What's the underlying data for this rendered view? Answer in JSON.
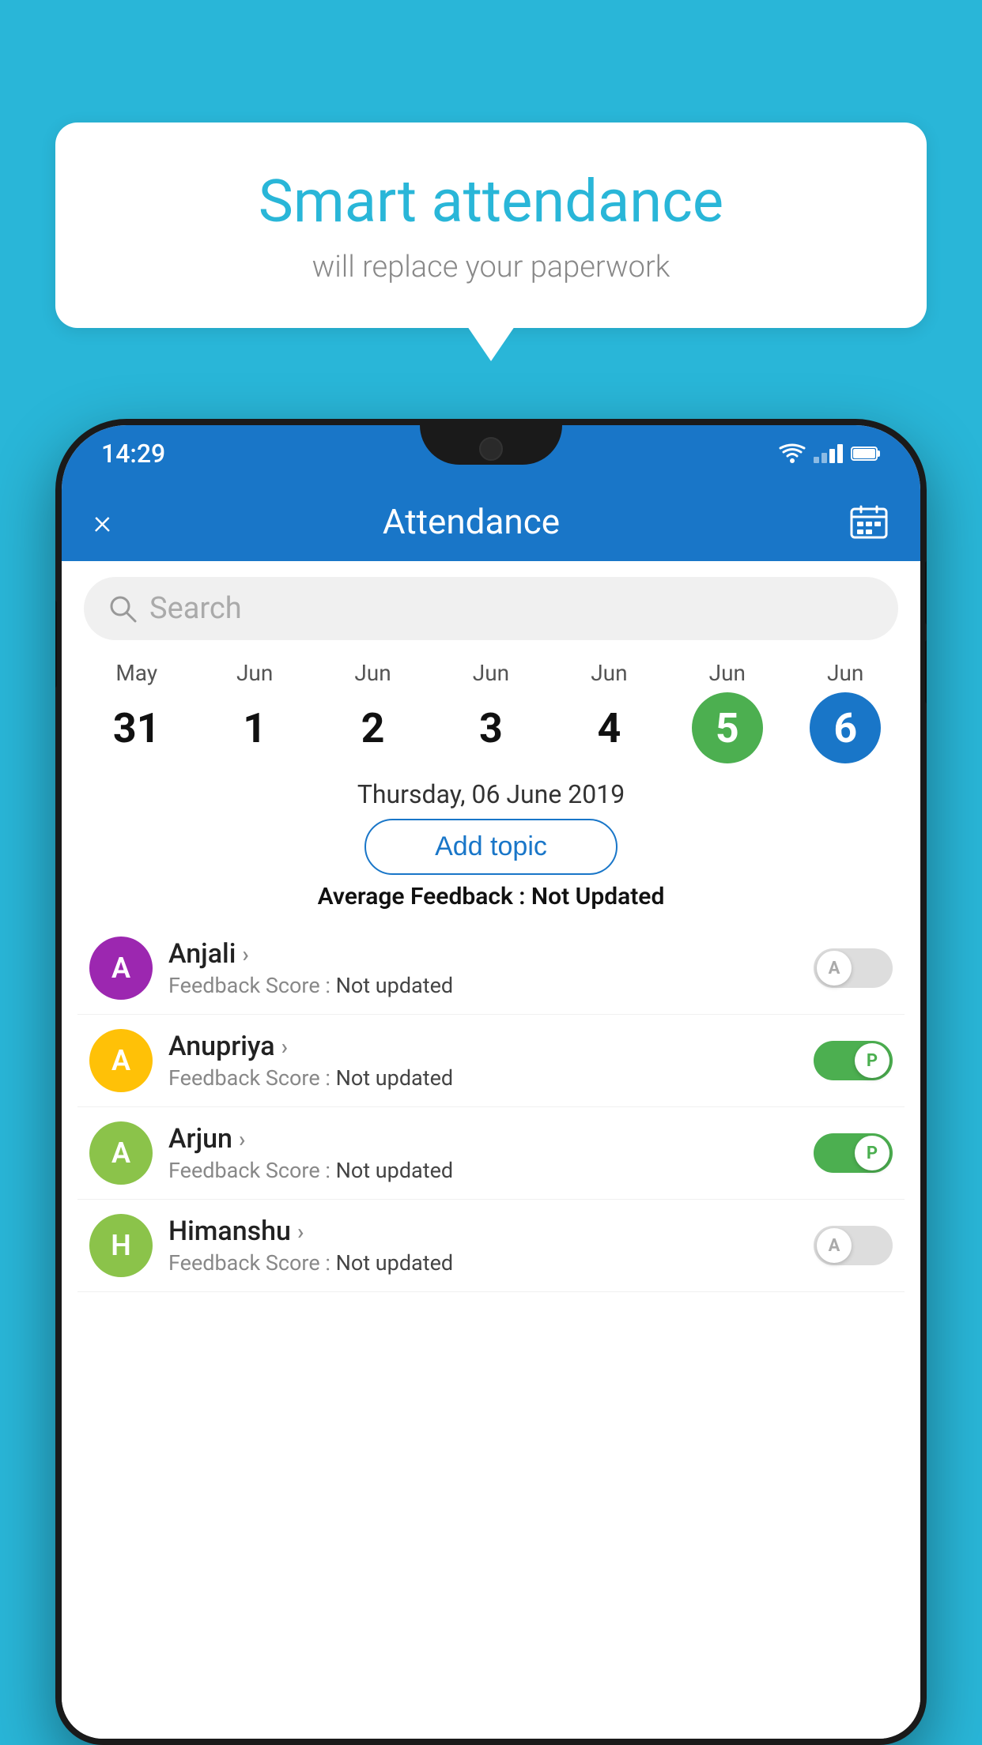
{
  "background_color": "#29B6D8",
  "bubble": {
    "title": "Smart attendance",
    "subtitle": "will replace your paperwork"
  },
  "status_bar": {
    "time": "14:29"
  },
  "header": {
    "title": "Attendance",
    "close_label": "×",
    "calendar_icon": "📅"
  },
  "search": {
    "placeholder": "Search"
  },
  "calendar": {
    "days": [
      {
        "month": "May",
        "date": "31",
        "state": "normal"
      },
      {
        "month": "Jun",
        "date": "1",
        "state": "normal"
      },
      {
        "month": "Jun",
        "date": "2",
        "state": "normal"
      },
      {
        "month": "Jun",
        "date": "3",
        "state": "normal"
      },
      {
        "month": "Jun",
        "date": "4",
        "state": "normal"
      },
      {
        "month": "Jun",
        "date": "5",
        "state": "today"
      },
      {
        "month": "Jun",
        "date": "6",
        "state": "selected"
      }
    ]
  },
  "selected_date_label": "Thursday, 06 June 2019",
  "add_topic_label": "Add topic",
  "avg_feedback_label": "Average Feedback : ",
  "avg_feedback_value": "Not Updated",
  "students": [
    {
      "name": "Anjali",
      "avatar_letter": "A",
      "avatar_color": "#9C27B0",
      "feedback_label": "Feedback Score : ",
      "feedback_value": "Not updated",
      "toggle_state": "off",
      "toggle_letter": "A"
    },
    {
      "name": "Anupriya",
      "avatar_letter": "A",
      "avatar_color": "#FFC107",
      "feedback_label": "Feedback Score : ",
      "feedback_value": "Not updated",
      "toggle_state": "on",
      "toggle_letter": "P"
    },
    {
      "name": "Arjun",
      "avatar_letter": "A",
      "avatar_color": "#8BC34A",
      "feedback_label": "Feedback Score : ",
      "feedback_value": "Not updated",
      "toggle_state": "on",
      "toggle_letter": "P"
    },
    {
      "name": "Himanshu",
      "avatar_letter": "H",
      "avatar_color": "#8BC34A",
      "feedback_label": "Feedback Score : ",
      "feedback_value": "Not updated",
      "toggle_state": "off",
      "toggle_letter": "A"
    }
  ]
}
